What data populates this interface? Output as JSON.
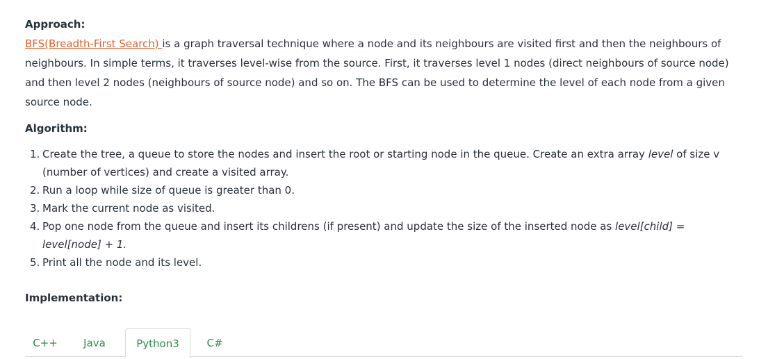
{
  "approach": {
    "heading": "Approach:",
    "link_text": "BFS(Breadth-First Search) ",
    "text_line": "is a graph traversal technique where a node and its neighbours are visited first and then the neighbours of neighbours. In simple terms, it traverses level-wise from the source. First, it traverses level 1 nodes (direct neighbours of source node) and then level 2 nodes (neighbours of source node) and so on. The BFS can be used to determine the level of each node from a given source node."
  },
  "algorithm": {
    "heading": "Algorithm:",
    "steps": [
      {
        "num": "1.",
        "text_a": "Create the tree, a queue to store the nodes and insert the root or starting node in the queue. Create an extra array ",
        "em": "level",
        "text_b": " of size v (number of vertices) and create a visited array."
      },
      {
        "num": "2.",
        "text": "Run a loop while size of queue is greater than 0."
      },
      {
        "num": "3.",
        "text": "Mark the current node as visited."
      },
      {
        "num": "4.",
        "text_a": "Pop one node from the queue and insert its childrens (if present) and update the size of the inserted node as ",
        "em": "level[child] = level[node] + 1."
      },
      {
        "num": "5.",
        "text": "Print all the node and its level."
      }
    ]
  },
  "implementation": {
    "heading": "Implementation:"
  },
  "tabs": [
    {
      "label": "C++",
      "active": false
    },
    {
      "label": "Java",
      "active": false
    },
    {
      "label": "Python3",
      "active": true
    },
    {
      "label": "C#",
      "active": false
    }
  ],
  "colors": {
    "link": "#e3602f",
    "tab_text": "#2f8d46",
    "body_text": "#273239"
  }
}
